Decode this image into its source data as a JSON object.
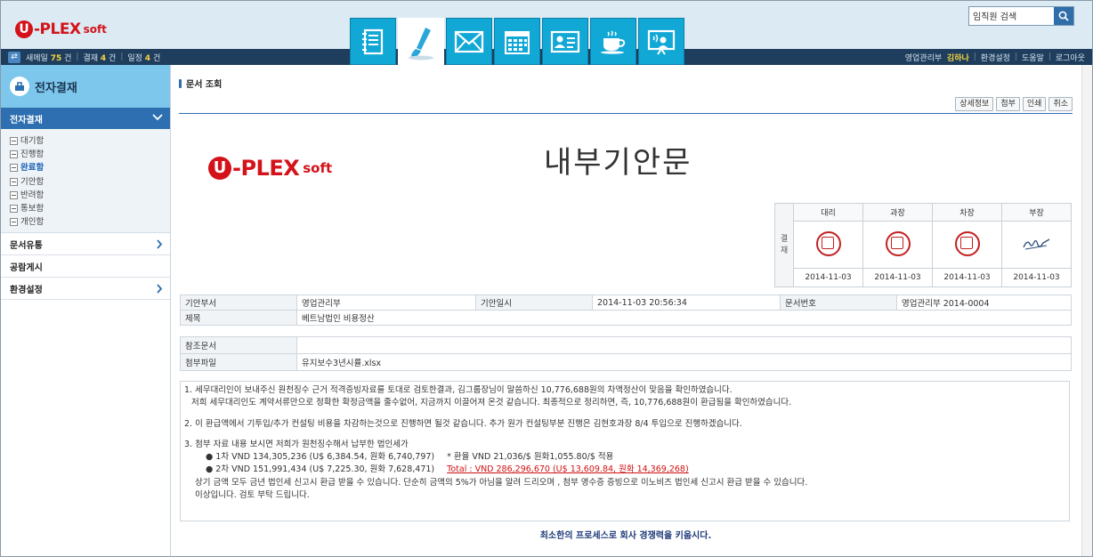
{
  "brand": {
    "u": "U",
    "name": "-PLEX",
    "soft": "soft"
  },
  "search": {
    "placeholder": "임직원 검색",
    "value": "임직원 검색"
  },
  "topnav": {
    "mail_label": "새메일",
    "mail_count": "75",
    "mail_unit": "건",
    "approval_label": "결재",
    "approval_count": "4",
    "approval_unit": "건",
    "schedule_label": "일정",
    "schedule_count": "4",
    "schedule_unit": "건",
    "dept": "영업관리부",
    "user": "김하나",
    "links": [
      "환경설정",
      "도움말",
      "로그아웃"
    ]
  },
  "tabs": [
    "notebook-icon",
    "brush-icon",
    "mail-icon",
    "calendar-icon",
    "contact-card-icon",
    "coffee-icon",
    "presentation-icon"
  ],
  "sidebar": {
    "title": "전자결재",
    "section": "전자결재",
    "items": [
      "대기함",
      "진행함",
      "완료함",
      "기안함",
      "반려함",
      "통보함",
      "개인함"
    ],
    "active_item": 2,
    "menus": [
      "문서유통",
      "공람게시",
      "환경설정"
    ]
  },
  "content": {
    "page_title": "문서 조회",
    "buttons": [
      "상세정보",
      "첨부",
      "인쇄",
      "취소"
    ],
    "doc_title": "내부기안문",
    "approval": {
      "label": "결재",
      "positions": [
        "대리",
        "과장",
        "차장",
        "부장"
      ],
      "dates": [
        "2014-11-03",
        "2014-11-03",
        "2014-11-03",
        "2014-11-03"
      ]
    },
    "info": {
      "drafter_dept_label": "기안부서",
      "drafter_dept": "영업관리부",
      "draft_date_label": "기안일시",
      "draft_date": "2014-11-03 20:56:34",
      "doc_no_label": "문서번호",
      "doc_no": "영업관리부 2014-0004",
      "subject_label": "제목",
      "subject": "베트남법인 비용정산",
      "ref_label": "참조문서",
      "ref": "",
      "attach_label": "첨부파일",
      "attach": "유지보수3년시률.xlsx"
    },
    "body": [
      "1. 세무대리인이 보내주신 원천징수 근거  적격증빙자료를 토대로 검토한결과, 김그룹장님이 말씀하신 10,776,688원의  차액정산이  맞음을 확인하였습니다.",
      "   저희 세무대리인도  계약서류만으로 정확한 확정금액을 줄수없어, 지금까지 이끌어져 온것 같습니다. 최종적으로 정리하면, 즉, 10,776,688원이 환급됨을 확인하였습니다.",
      "2. 이  환급액에서  기투입/추가 컨설팅 비용을 차감하는것으로 진행하면 될것 같습니다.  추가 원가 컨설팅부분  진행은 김현호과장  8/4 투입으로 진행하겠습니다.",
      "3. 첨부 자료 내용 보시면 저희가 원천징수해서 납부한 법인세가",
      "● 1차 VND 134,305,236 (U$ 6,384.54, 원화 6,740,797)",
      "* 환율 VND 21,036/$   원화1,055.80/$ 적용",
      "● 2차 VND 151,991,434 (U$ 7,225.30, 원화 7,628,471)",
      "Total : VND 286,296,670 (U$ 13,609.84, 원화 14,369,268)",
      "상기 금액 모두 금년 법인세 신고시 환급 받을 수 있습니다. 단순히 금액의 5%가 아님을 알려 드리오며 , 첨부 영수증 증빙으로 이노비즈 법인세 신고시 환급 받을 수 있습니다.",
      "이상입니다. 검토 부탁 드립니다."
    ],
    "footer": "최소한의 프로세스로 회사 경쟁력을 키웁시다."
  },
  "colors": {
    "brand_red": "#d4121a",
    "nav_dark": "#1f3e5e",
    "tab_blue": "#12a8d6",
    "sidebar_blue": "#2d6fb0",
    "highlight_yellow": "#f5d43a"
  }
}
